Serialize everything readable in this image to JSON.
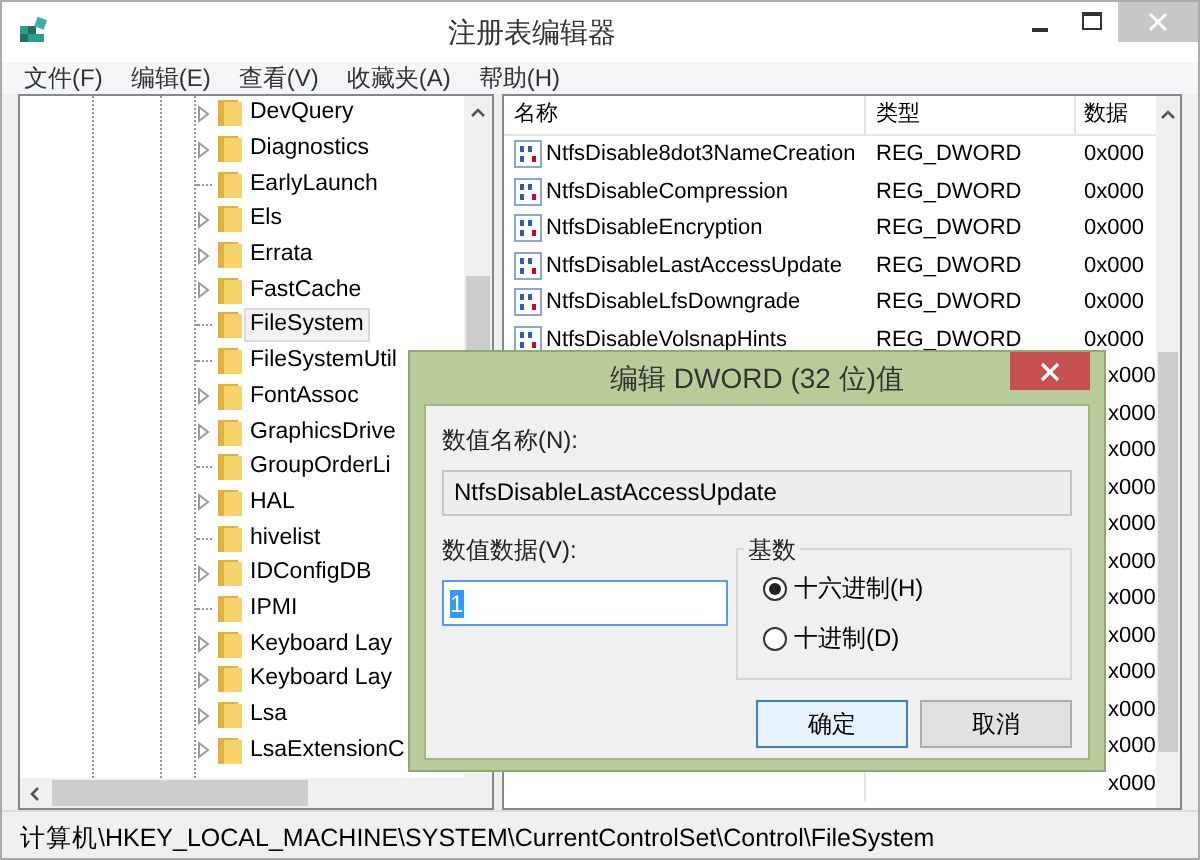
{
  "window": {
    "title": "注册表编辑器"
  },
  "menu": [
    "文件(F)",
    "编辑(E)",
    "查看(V)",
    "收藏夹(A)",
    "帮助(H)"
  ],
  "tree": {
    "items": [
      {
        "label": "DevQuery",
        "expandable": true,
        "selected": false
      },
      {
        "label": "Diagnostics",
        "expandable": true,
        "selected": false
      },
      {
        "label": "EarlyLaunch",
        "expandable": false,
        "selected": false
      },
      {
        "label": "Els",
        "expandable": true,
        "selected": false
      },
      {
        "label": "Errata",
        "expandable": true,
        "selected": false
      },
      {
        "label": "FastCache",
        "expandable": true,
        "selected": false
      },
      {
        "label": "FileSystem",
        "expandable": false,
        "selected": true
      },
      {
        "label": "FileSystemUtil",
        "expandable": false,
        "selected": false
      },
      {
        "label": "FontAssoc",
        "expandable": true,
        "selected": false
      },
      {
        "label": "GraphicsDrive",
        "expandable": true,
        "selected": false
      },
      {
        "label": "GroupOrderLi",
        "expandable": false,
        "selected": false
      },
      {
        "label": "HAL",
        "expandable": true,
        "selected": false
      },
      {
        "label": "hivelist",
        "expandable": false,
        "selected": false
      },
      {
        "label": "IDConfigDB",
        "expandable": true,
        "selected": false
      },
      {
        "label": "IPMI",
        "expandable": false,
        "selected": false
      },
      {
        "label": "Keyboard Lay",
        "expandable": true,
        "selected": false
      },
      {
        "label": "Keyboard Lay",
        "expandable": true,
        "selected": false
      },
      {
        "label": "Lsa",
        "expandable": true,
        "selected": false
      },
      {
        "label": "LsaExtensionC",
        "expandable": true,
        "selected": false
      }
    ]
  },
  "list": {
    "columns": [
      "名称",
      "类型",
      "数据"
    ],
    "rows": [
      {
        "name": "NtfsDisable8dot3NameCreation",
        "type": "REG_DWORD",
        "data": "0x000"
      },
      {
        "name": "NtfsDisableCompression",
        "type": "REG_DWORD",
        "data": "0x000"
      },
      {
        "name": "NtfsDisableEncryption",
        "type": "REG_DWORD",
        "data": "0x000"
      },
      {
        "name": "NtfsDisableLastAccessUpdate",
        "type": "REG_DWORD",
        "data": "0x000"
      },
      {
        "name": "NtfsDisableLfsDowngrade",
        "type": "REG_DWORD",
        "data": "0x000"
      },
      {
        "name": "NtfsDisableVolsnapHints",
        "type": "REG_DWORD",
        "data": "0x000"
      }
    ],
    "covered_rows": [
      {
        "data": "x000"
      },
      {
        "data": "x000"
      },
      {
        "data": "x000"
      },
      {
        "data": "x000"
      },
      {
        "data": "x000"
      },
      {
        "data": "x000"
      },
      {
        "data": "x000"
      },
      {
        "data": "x000"
      },
      {
        "data": "x000"
      },
      {
        "data": "x000"
      },
      {
        "data": "x000"
      },
      {
        "data": "x000"
      }
    ]
  },
  "dialog": {
    "title": "编辑 DWORD (32 位)值",
    "name_label": "数值名称(N):",
    "name_value": "NtfsDisableLastAccessUpdate",
    "data_label": "数值数据(V):",
    "data_value": "1",
    "base_label": "基数",
    "radios": [
      {
        "label": "十六进制(H)",
        "selected": true
      },
      {
        "label": "十进制(D)",
        "selected": false
      }
    ],
    "buttons": [
      {
        "label": "确定",
        "default": true
      },
      {
        "label": "取消",
        "default": false
      }
    ]
  },
  "status_bar": "计算机\\HKEY_LOCAL_MACHINE\\SYSTEM\\CurrentControlSet\\Control\\FileSystem"
}
